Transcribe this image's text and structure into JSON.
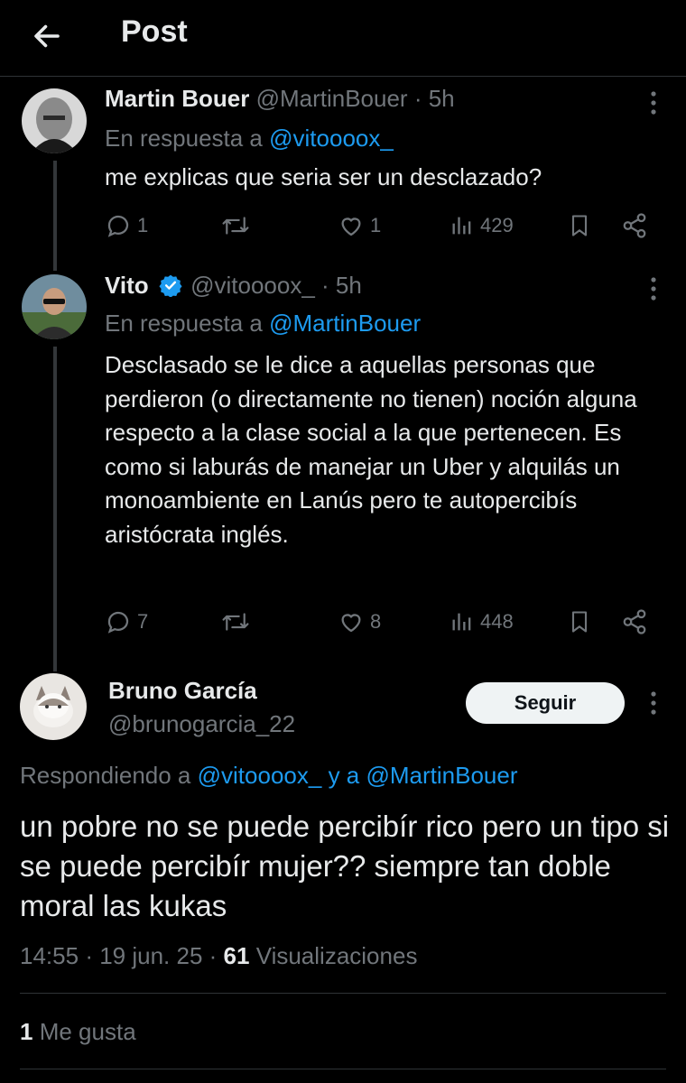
{
  "header": {
    "title": "Post"
  },
  "tweets": [
    {
      "name": "Martin Bouer",
      "handle": "@MartinBouer",
      "time": "· 5h",
      "reply_prefix": "En respuesta a",
      "reply_to": "@vitoooox_",
      "text": "me explicas que seria ser un desclazado?",
      "replies": "1",
      "reposts": "",
      "likes": "1",
      "views": "429"
    },
    {
      "name": "Vito",
      "handle": "@vitoooox_",
      "time": "· 5h",
      "verified": true,
      "reply_prefix": "En respuesta a",
      "reply_to": "@MartinBouer",
      "text": "Desclasado se le dice a aquellas personas que perdieron (o directamente no tienen) noción alguna respecto a la clase social a la que pertenecen. Es como si laburás de manejar un Uber y alquilás un monoambiente en Lanús pero te autopercibís aristócrata inglés.",
      "replies": "7",
      "reposts": "",
      "likes": "8",
      "views": "448"
    }
  ],
  "main_tweet": {
    "name": "Bruno García",
    "handle": "@brunogarcia_22",
    "follow_label": "Seguir",
    "reply_prefix": "Respondiendo a",
    "reply_to_1": "@vitoooox_",
    "reply_join": "y a",
    "reply_to_2": "@MartinBouer",
    "text": "un pobre no se puede percibír rico pero un tipo si se puede percibír mujer?? siempre tan doble moral las kukas",
    "time": "14:55",
    "date": "19 jun. 25",
    "views_count": "61",
    "views_label": "Visualizaciones",
    "likes_count": "1",
    "likes_label": "Me gusta"
  },
  "colors": {
    "accent": "#1d9bf0",
    "muted": "#71767b",
    "text": "#e7e9ea",
    "background": "#000000"
  },
  "icons": [
    "back-arrow-icon",
    "more-icon",
    "reply-icon",
    "repost-icon",
    "like-icon",
    "views-icon",
    "bookmark-icon",
    "share-icon",
    "verified-icon"
  ]
}
